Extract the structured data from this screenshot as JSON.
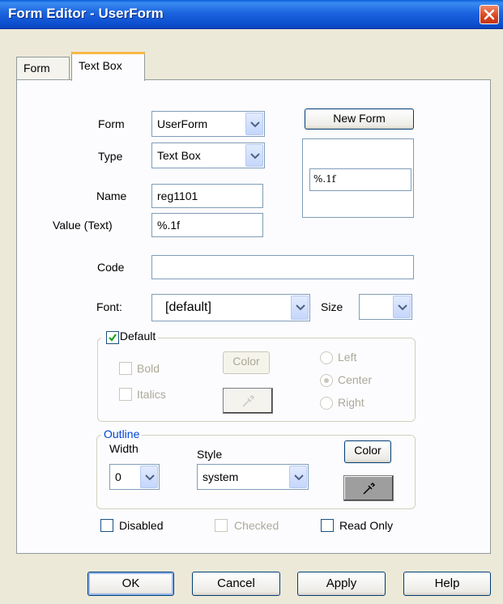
{
  "window": {
    "title": "Form Editor - UserForm"
  },
  "tabs": [
    {
      "label": "Form"
    },
    {
      "label": "Text Box"
    }
  ],
  "form_row": {
    "label": "Form",
    "value": "UserForm",
    "new_form_label": "New Form"
  },
  "type_row": {
    "label": "Type",
    "value": "Text Box"
  },
  "name_row": {
    "label": "Name",
    "value": "reg1101"
  },
  "value_row": {
    "label": "Value (Text)",
    "value": "%.1f"
  },
  "preview": {
    "value": "%.1f"
  },
  "code_row": {
    "label": "Code",
    "value": ""
  },
  "font_row": {
    "label": "Font:",
    "value": "[default]",
    "size_label": "Size",
    "size_value": ""
  },
  "default_group": {
    "title": "Default",
    "checked": true,
    "bold": "Bold",
    "italics": "Italics",
    "color_label": "Color",
    "align_left": "Left",
    "align_center": "Center",
    "align_right": "Right"
  },
  "outline_group": {
    "title": "Outline",
    "width_label": "Width",
    "width_value": "0",
    "style_label": "Style",
    "style_value": "system",
    "color_label": "Color",
    "title_color": "#0046d5"
  },
  "options": {
    "disabled": "Disabled",
    "checked": "Checked",
    "read_only": "Read Only"
  },
  "buttons": {
    "ok": "OK",
    "cancel": "Cancel",
    "apply": "Apply",
    "help": "Help"
  },
  "colors": {
    "titlebar": "#0a5fd8",
    "close": "#d9431d",
    "tab_highlight": "#f9b848"
  }
}
